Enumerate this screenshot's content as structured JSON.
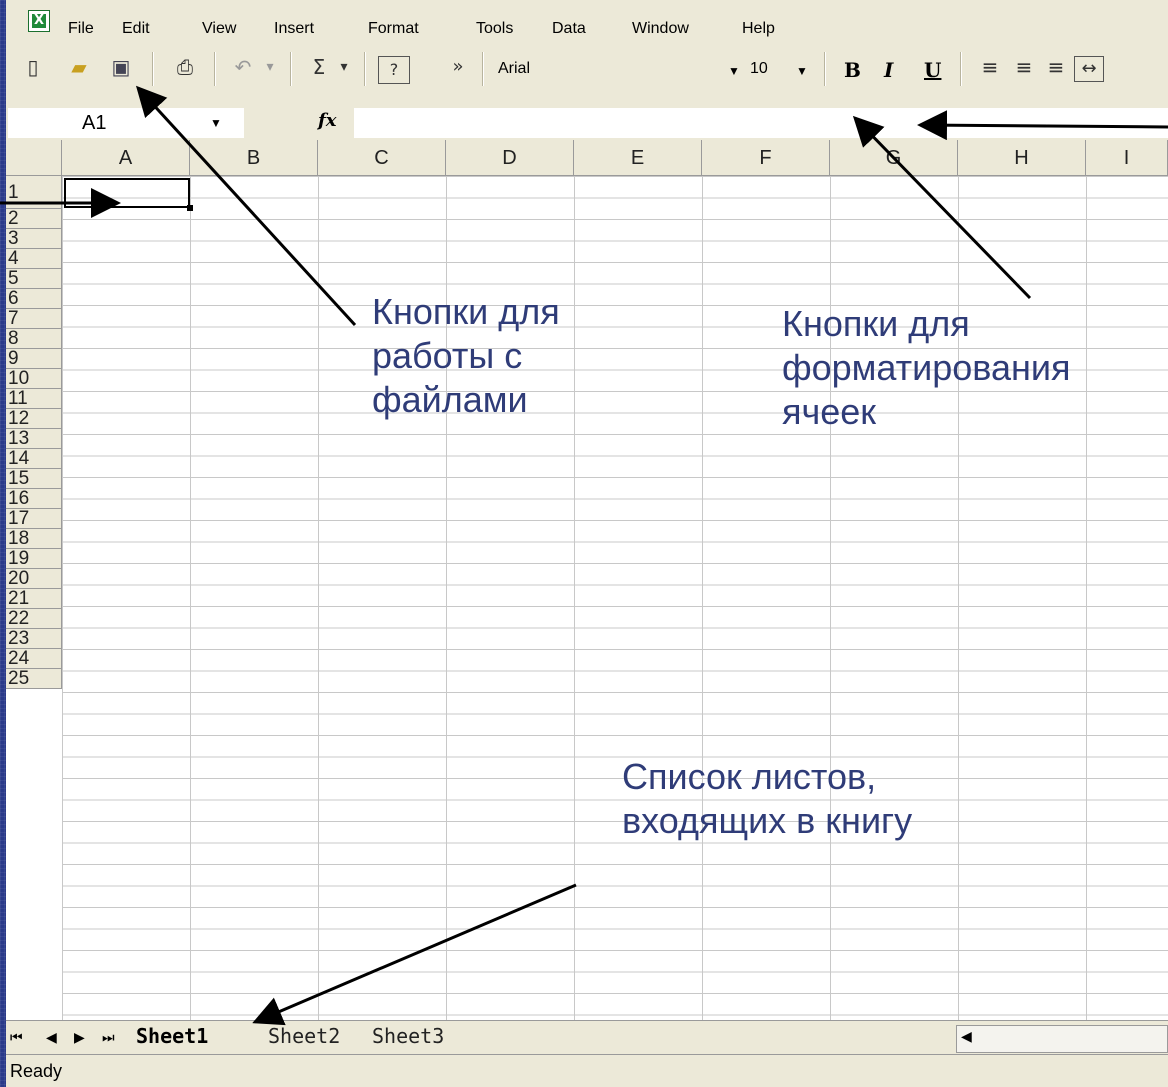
{
  "menu": [
    "File",
    "Edit",
    "View",
    "Insert",
    "Format",
    "Tools",
    "Data",
    "Window",
    "Help"
  ],
  "toolbar": {
    "font_name": "Arial",
    "font_size": "10",
    "bold": "B",
    "italic": "I",
    "underline": "U",
    "sigma": "Σ",
    "help": "?",
    "overflow": "»"
  },
  "formula_bar": {
    "name_box": "A1",
    "fx": "fx",
    "value": ""
  },
  "columns": [
    "A",
    "B",
    "C",
    "D",
    "E",
    "F",
    "G",
    "H",
    "I"
  ],
  "rows": [
    "1",
    "2",
    "3",
    "4",
    "5",
    "6",
    "7",
    "8",
    "9",
    "10",
    "11",
    "12",
    "13",
    "14",
    "15",
    "16",
    "17",
    "18",
    "19",
    "20",
    "21",
    "22",
    "23",
    "24",
    "25"
  ],
  "sheets": [
    "Sheet1",
    "Sheet2",
    "Sheet3"
  ],
  "active_sheet": "Sheet1",
  "status": "Ready",
  "annotations": {
    "file_buttons": "Кнопки для\nработы с\nфайлами",
    "format_buttons": "Кнопки для\nформатирования\nячеек",
    "sheet_list": "Список листов,\nвходящих в книгу"
  },
  "colors": {
    "background": "#2a3a8a",
    "chrome": "#ece9d8",
    "annotation_text": "#2f3c78"
  }
}
